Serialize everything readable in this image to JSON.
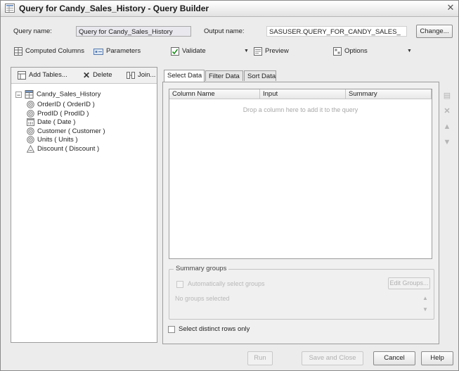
{
  "window": {
    "title": "Query for Candy_Sales_History - Query Builder"
  },
  "header": {
    "query_name_label": "Query name:",
    "query_name_value": "Query for Candy_Sales_History",
    "output_name_label": "Output name:",
    "output_name_value": "SASUSER.QUERY_FOR_CANDY_SALES_",
    "change_label": "Change..."
  },
  "toolbar": {
    "computed_columns": "Computed Columns",
    "parameters": "Parameters",
    "validate": "Validate",
    "preview": "Preview",
    "options": "Options"
  },
  "left_panel": {
    "add_tables": "Add Tables...",
    "delete": "Delete",
    "join": "Join...",
    "table_name": "Candy_Sales_History",
    "columns": [
      {
        "label": "OrderID ( OrderID )",
        "icon": "numeric-column-icon"
      },
      {
        "label": "ProdID ( ProdID )",
        "icon": "numeric-column-icon"
      },
      {
        "label": "Date ( Date )",
        "icon": "date-column-icon"
      },
      {
        "label": "Customer ( Customer )",
        "icon": "numeric-column-icon"
      },
      {
        "label": "Units ( Units )",
        "icon": "numeric-column-icon"
      },
      {
        "label": "Discount ( Discount )",
        "icon": "character-column-icon"
      }
    ]
  },
  "tabs": [
    "Select Data",
    "Filter Data",
    "Sort Data"
  ],
  "grid": {
    "columns": [
      "Column Name",
      "Input",
      "Summary"
    ],
    "empty_hint": "Drop a column here to add it to the query"
  },
  "summary_groups": {
    "title": "Summary groups",
    "auto_select_label": "Automatically select groups",
    "edit_groups": "Edit Groups...",
    "no_groups": "No groups selected"
  },
  "select_distinct": "Select distinct rows only",
  "footer": {
    "run": "Run",
    "save_close": "Save and Close",
    "cancel": "Cancel",
    "help": "Help"
  }
}
